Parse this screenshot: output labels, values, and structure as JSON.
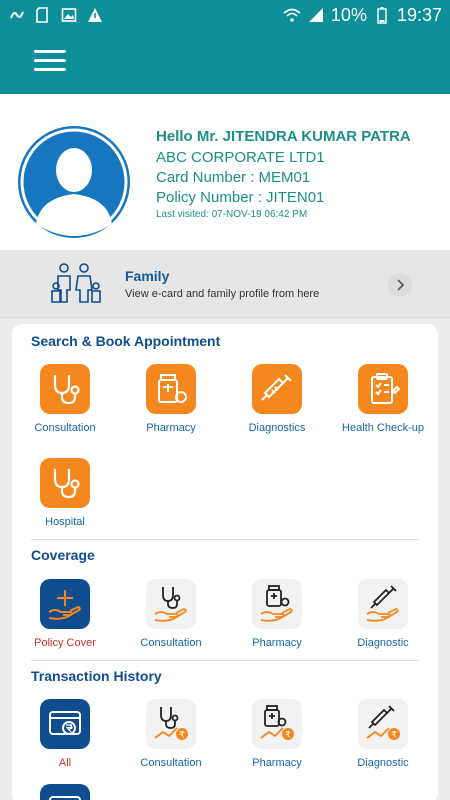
{
  "status_bar": {
    "battery": "10%",
    "time": "19:37"
  },
  "profile": {
    "greeting": "Hello Mr. JITENDRA KUMAR PATRA",
    "company": "ABC CORPORATE LTD1",
    "card_number": "Card Number : MEM01",
    "policy_number": "Policy Number : JITEN01",
    "last_visited": "Last visited: 07-NOV-19 06:42 PM"
  },
  "family": {
    "title": "Family",
    "subtitle": "View e-card and family profile from here"
  },
  "search_section": {
    "title": "Search & Book Appointment",
    "items": [
      {
        "label": "Consultation",
        "icon": "stethoscope-icon"
      },
      {
        "label": "Pharmacy",
        "icon": "pharmacy-icon"
      },
      {
        "label": "Diagnostics",
        "icon": "syringe-icon"
      },
      {
        "label": "Health Check-up",
        "icon": "clipboard-icon"
      },
      {
        "label": "Hospital",
        "icon": "stethoscope-icon"
      }
    ]
  },
  "coverage_section": {
    "title": "Coverage",
    "items": [
      {
        "label": "Policy Cover",
        "icon": "policy-cover-icon"
      },
      {
        "label": "Consultation",
        "icon": "stethoscope-hand-icon"
      },
      {
        "label": "Pharmacy",
        "icon": "pharmacy-hand-icon"
      },
      {
        "label": "Diagnostic",
        "icon": "syringe-hand-icon"
      }
    ]
  },
  "transaction_section": {
    "title": "Transaction History",
    "items": [
      {
        "label": "All",
        "icon": "wallet-card-icon"
      },
      {
        "label": "Consultation",
        "icon": "stethoscope-rupee-icon"
      },
      {
        "label": "Pharmacy",
        "icon": "pharmacy-rupee-icon"
      },
      {
        "label": "Diagnostic",
        "icon": "syringe-rupee-icon"
      }
    ]
  },
  "colors": {
    "teal": "#0c8f98",
    "navy": "#0f4d8f",
    "orange": "#f5871f",
    "accent_red": "#c8302a"
  }
}
